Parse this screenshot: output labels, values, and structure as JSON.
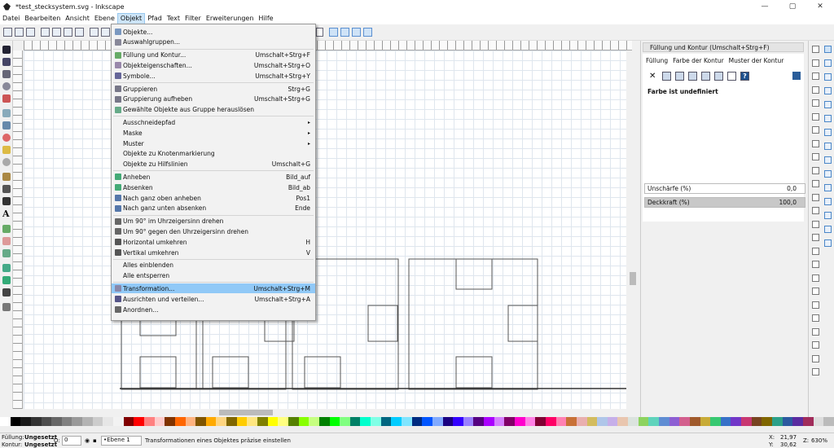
{
  "window": {
    "title": "*test_stecksystem.svg - Inkscape"
  },
  "menubar": [
    "Datei",
    "Bearbeiten",
    "Ansicht",
    "Ebene",
    "Objekt",
    "Pfad",
    "Text",
    "Filter",
    "Erweiterungen",
    "Hilfe"
  ],
  "menu": [
    {
      "label": "Objekte...",
      "shortcut": "",
      "icon": "objects-icon"
    },
    {
      "label": "Auswahlgruppen...",
      "shortcut": "",
      "icon": "selection-sets-icon"
    },
    {
      "label": "Füllung und Kontur...",
      "shortcut": "Umschalt+Strg+F",
      "icon": "fill-stroke-icon"
    },
    {
      "label": "Objekteigenschaften...",
      "shortcut": "Umschalt+Strg+O",
      "icon": "object-properties-icon"
    },
    {
      "label": "Symbole...",
      "shortcut": "Umschalt+Strg+Y",
      "icon": "symbols-icon"
    },
    {
      "label": "Gruppieren",
      "shortcut": "Strg+G",
      "icon": "group-icon"
    },
    {
      "label": "Gruppierung aufheben",
      "shortcut": "Umschalt+Strg+G",
      "icon": "ungroup-icon"
    },
    {
      "label": "Gewählte Objekte aus Gruppe herauslösen",
      "shortcut": "",
      "icon": "pop-from-group-icon"
    },
    {
      "label": "Ausschneidepfad",
      "shortcut": "",
      "icon": "",
      "submenu": true
    },
    {
      "label": "Maske",
      "shortcut": "",
      "icon": "",
      "submenu": true
    },
    {
      "label": "Muster",
      "shortcut": "",
      "icon": "",
      "submenu": true
    },
    {
      "label": "Objekte zu Knotenmarkierung",
      "shortcut": "",
      "icon": ""
    },
    {
      "label": "Objekte zu Hilfslinien",
      "shortcut": "Umschalt+G",
      "icon": ""
    },
    {
      "label": "Anheben",
      "shortcut": "Bild_auf",
      "icon": "raise-icon"
    },
    {
      "label": "Absenken",
      "shortcut": "Bild_ab",
      "icon": "lower-icon"
    },
    {
      "label": "Nach ganz oben anheben",
      "shortcut": "Pos1",
      "icon": "raise-to-top-icon"
    },
    {
      "label": "Nach ganz unten absenken",
      "shortcut": "Ende",
      "icon": "lower-to-bottom-icon"
    },
    {
      "label": "Um 90° im Uhrzeigersinn drehen",
      "shortcut": "",
      "icon": "rotate-cw-icon"
    },
    {
      "label": "Um 90° gegen den Uhrzeigersinn drehen",
      "shortcut": "",
      "icon": "rotate-ccw-icon"
    },
    {
      "label": "Horizontal umkehren",
      "shortcut": "H",
      "icon": "flip-horizontal-icon"
    },
    {
      "label": "Vertikal umkehren",
      "shortcut": "V",
      "icon": "flip-vertical-icon"
    },
    {
      "label": "Alles einblenden",
      "shortcut": "",
      "icon": ""
    },
    {
      "label": "Alle entsperren",
      "shortcut": "",
      "icon": ""
    },
    {
      "label": "Transformation...",
      "shortcut": "Umschalt+Strg+M",
      "icon": "transform-icon",
      "highlighted": true
    },
    {
      "label": "Ausrichten und verteilen...",
      "shortcut": "Umschalt+Strg+A",
      "icon": "align-distribute-icon"
    },
    {
      "label": "Anordnen...",
      "shortcut": "",
      "icon": "arrange-icon"
    }
  ],
  "panel": {
    "title": "Füllung und Kontur (Umschalt+Strg+F)",
    "tabs": [
      "Füllung",
      "Farbe der Kontur",
      "Muster der Kontur"
    ],
    "undefined_label": "Farbe ist undefiniert",
    "blur_label": "Unschärfe (%)",
    "blur_value": "0,0",
    "opacity_label": "Deckkraft (%)",
    "opacity_value": "100,0"
  },
  "status": {
    "fill_label": "Füllung:",
    "fill_value": "Ungesetzt",
    "stroke_label": "Kontur:",
    "stroke_value": "Ungesetzt",
    "o_label": "O:",
    "o_value": "0",
    "layer": "•Ebene 1",
    "message": "Transformationen eines Objektes präzise einstellen",
    "x_label": "X:",
    "x_value": "21,97",
    "y_label": "Y:",
    "y_value": "30,62",
    "z_label": "Z:",
    "zoom": "630%"
  },
  "colors": {
    "menu_highlight": "#91c9f7",
    "accent": "#cce4f7"
  }
}
